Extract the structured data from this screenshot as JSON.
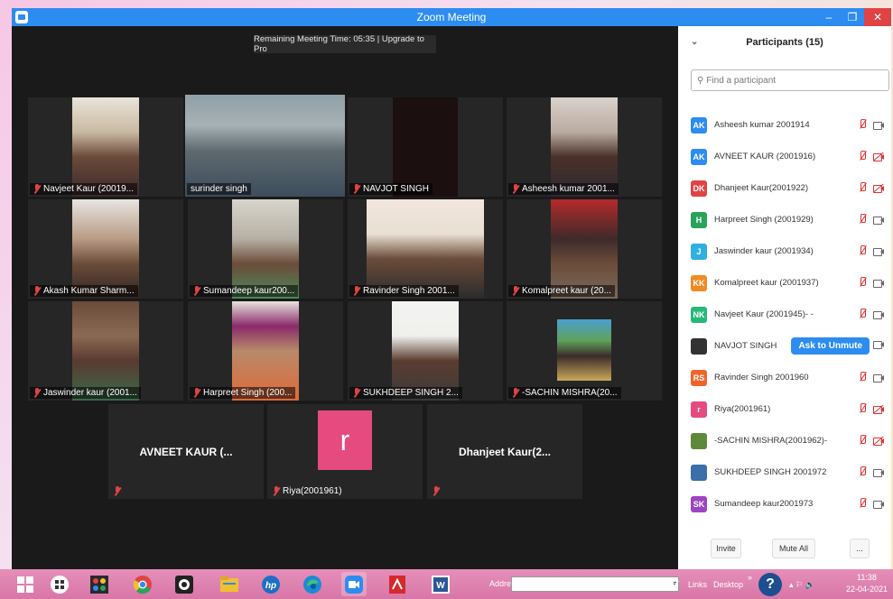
{
  "window": {
    "title": "Zoom Meeting",
    "minimize": "–",
    "maximize": "❐",
    "close": "✕"
  },
  "banner": "Remaining Meeting Time: 05:35 | Upgrade to Pro",
  "tiles": [
    "Navjeet Kaur (20019...",
    "surinder singh",
    "NAVJOT SINGH",
    "Asheesh kumar 2001...",
    "Akash Kumar Sharm...",
    "Sumandeep kaur200...",
    "Ravinder Singh 2001...",
    "Komalpreet kaur (20...",
    "Jaswinder kaur (2001...",
    "Harpreet Singh (200...",
    "SUKHDEEP SINGH 2...",
    "-SACHIN MISHRA(20..."
  ],
  "bottom_tiles": {
    "avneet": "AVNEET KAUR (...",
    "riya_letter": "r",
    "riya": "Riya(2001961)",
    "dhanjeet": "Dhanjeet  Kaur(2..."
  },
  "sidebar": {
    "title": "Participants (15)",
    "search_placeholder": "Find a participant",
    "invite": "Invite",
    "mute_all": "Mute All",
    "more": "...",
    "ask_unmute": "Ask to Unmute",
    "participants": [
      {
        "initials": "AK",
        "name": "Asheesh kumar 2001914",
        "color": "#2d8cf0",
        "cam_off": false
      },
      {
        "initials": "AK",
        "name": "AVNEET KAUR (2001916)",
        "color": "#2d8cf0",
        "cam_off": true
      },
      {
        "initials": "DK",
        "name": "Dhanjeet Kaur(2001922)",
        "color": "#e04343",
        "cam_off": true
      },
      {
        "initials": "H",
        "name": "Harpreet Singh (2001929)",
        "color": "#2aa35a",
        "cam_off": false
      },
      {
        "initials": "J",
        "name": "Jaswinder kaur (2001934)",
        "color": "#2fb0e0",
        "cam_off": false
      },
      {
        "initials": "KK",
        "name": "Komalpreet kaur (2001937)",
        "color": "#f08a24",
        "cam_off": false
      },
      {
        "initials": "NK",
        "name": "Navjeet Kaur (2001945)- -",
        "color": "#27b87a",
        "cam_off": false
      },
      {
        "initials": "",
        "name": "NAVJOT SINGH",
        "color": "#333333",
        "cam_off": false
      },
      {
        "initials": "RS",
        "name": "Ravinder Singh 2001960",
        "color": "#f0642a",
        "cam_off": false
      },
      {
        "initials": "r",
        "name": "Riya(2001961)",
        "color": "#e54b7e",
        "cam_off": true
      },
      {
        "initials": "",
        "name": "-SACHIN MISHRA(2001962)-",
        "color": "#5d8a3a",
        "cam_off": true
      },
      {
        "initials": "",
        "name": "SUKHDEEP SINGH 2001972",
        "color": "#3a6fa8",
        "cam_off": false
      },
      {
        "initials": "SK",
        "name": "Sumandeep kaur2001973",
        "color": "#9b45c4",
        "cam_off": false
      }
    ]
  },
  "taskbar": {
    "address_label": "Address",
    "links": "Links",
    "desktop": "Desktop",
    "time": "11:38",
    "date": "22-04-2021"
  }
}
